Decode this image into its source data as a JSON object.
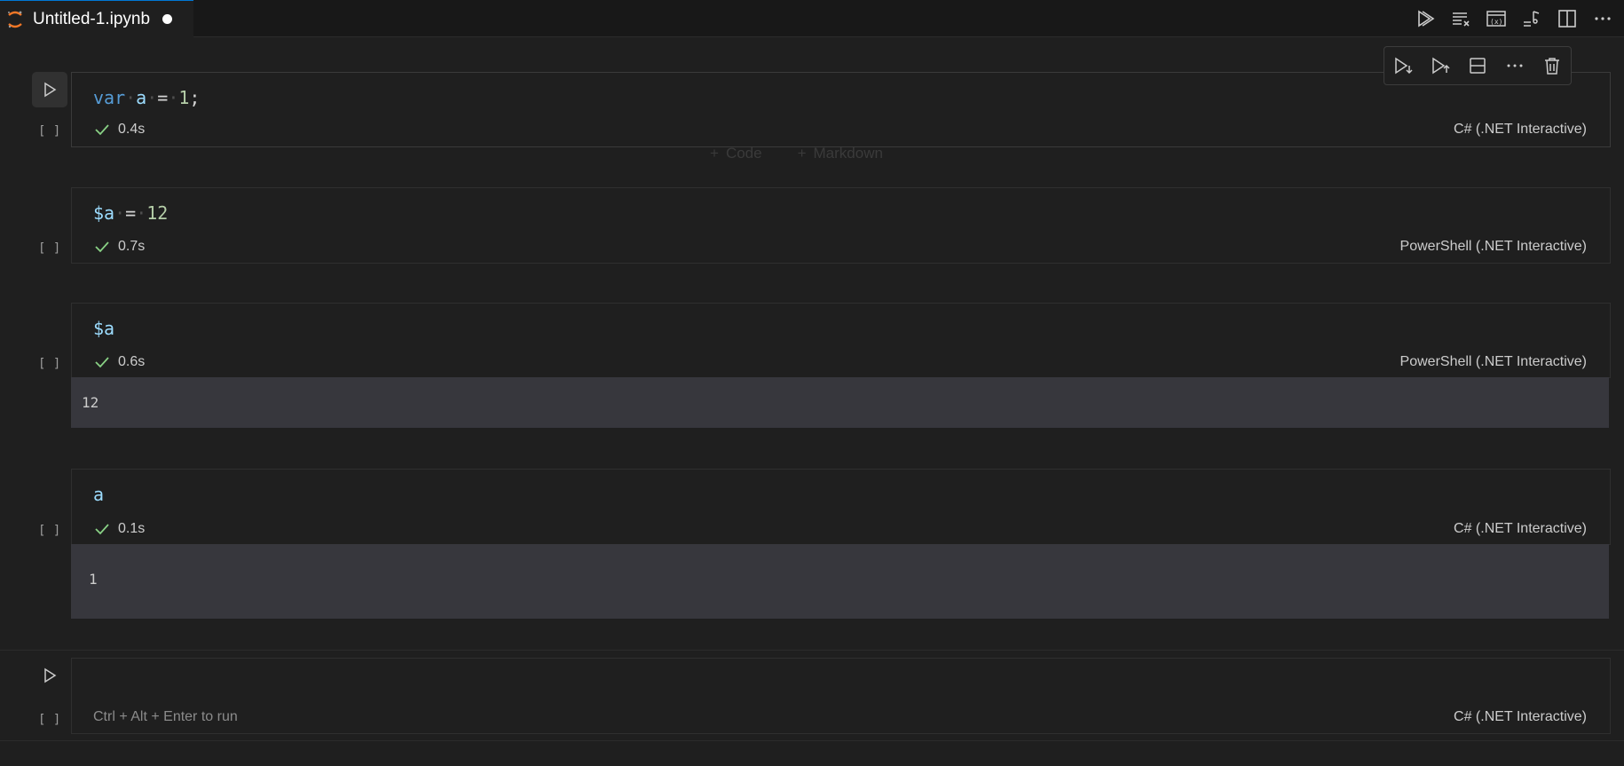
{
  "tab": {
    "title": "Untitled-1.ipynb"
  },
  "add_cell": {
    "code_label": "Code",
    "markdown_label": "Markdown"
  },
  "cells": [
    {
      "exec_count": "[ ]",
      "code": {
        "kw": "var",
        "name": "a",
        "op": "=",
        "value": "1",
        "tail": ";"
      },
      "time": "0.4s",
      "language": "C# (.NET Interactive)"
    },
    {
      "exec_count": "[ ]",
      "code": {
        "name": "$a",
        "op": "=",
        "value": "12"
      },
      "time": "0.7s",
      "language": "PowerShell (.NET Interactive)"
    },
    {
      "exec_count": "[ ]",
      "code": {
        "name": "$a"
      },
      "time": "0.6s",
      "language": "PowerShell (.NET Interactive)",
      "output": "12"
    },
    {
      "exec_count": "[ ]",
      "code": {
        "name": "a"
      },
      "time": "0.1s",
      "language": "C# (.NET Interactive)",
      "output": "1"
    },
    {
      "exec_count": "[ ]",
      "placeholder": "Ctrl + Alt + Enter to run",
      "language": "C# (.NET Interactive)"
    }
  ],
  "colors": {
    "accent_check": "#89d185",
    "output_bg": "#37373d"
  }
}
